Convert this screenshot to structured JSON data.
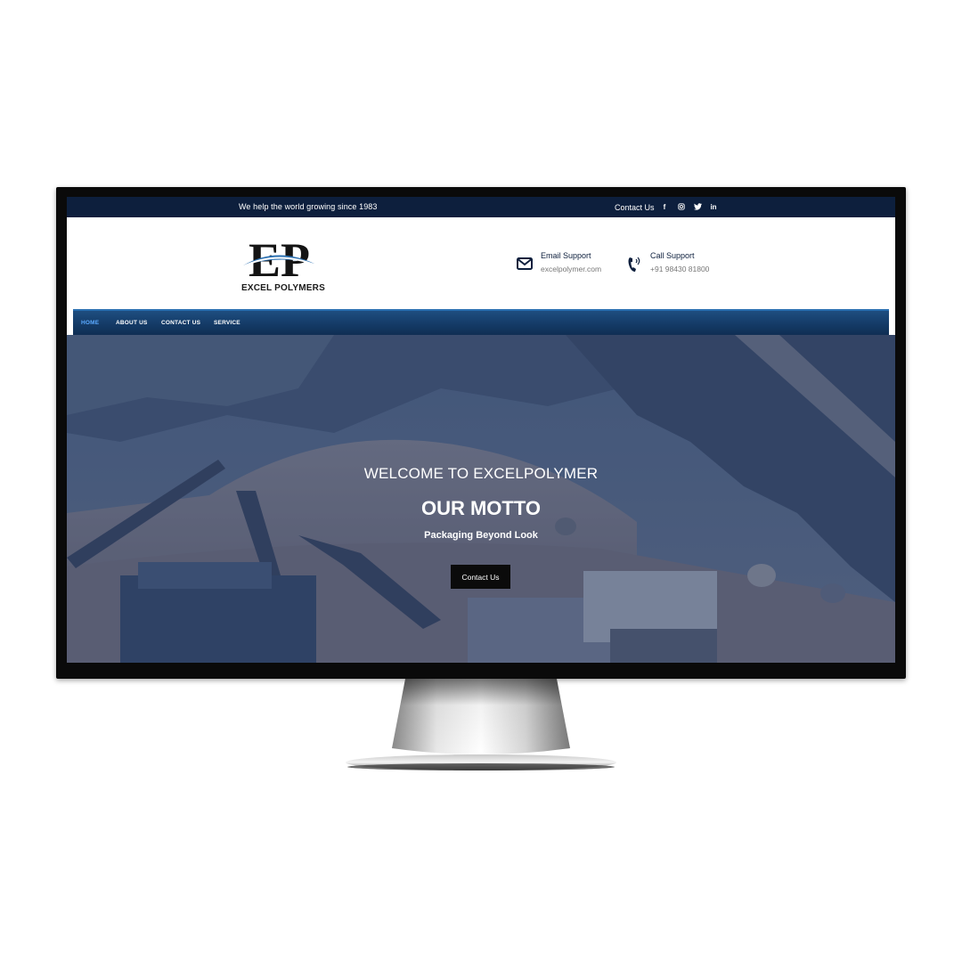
{
  "topbar": {
    "tagline": "We help the world growing since 1983",
    "contact_label": "Contact Us",
    "social": [
      {
        "icon": "facebook-icon",
        "glyph": "f"
      },
      {
        "icon": "instagram-icon",
        "glyph": "◎"
      },
      {
        "icon": "twitter-icon",
        "glyph": "🐦"
      },
      {
        "icon": "linkedin-icon",
        "glyph": "in"
      }
    ]
  },
  "header": {
    "logo_letters": "EP",
    "logo_text": "EXCEL POLYMERS",
    "email": {
      "title": "Email Support",
      "value": "excelpolymer.com",
      "icon": "envelope-icon"
    },
    "call": {
      "title": "Call Support",
      "value": "+91 98430 81800",
      "icon": "phone-icon"
    }
  },
  "nav": {
    "items": [
      {
        "label": "HOME",
        "active": true
      },
      {
        "label": "ABOUT US",
        "active": false
      },
      {
        "label": "CONTACT US",
        "active": false
      },
      {
        "label": "SERVICE",
        "active": false
      }
    ]
  },
  "hero": {
    "welcome": "WELCOME TO EXCELPOLYMER",
    "motto": "OUR MOTTO",
    "subtitle": "Packaging Beyond Look",
    "button_label": "Contact Us"
  },
  "colors": {
    "topbar": "#0d1f3d",
    "nav": "#133863",
    "nav_active": "#5aa9ff",
    "button": "#0b0b0b"
  }
}
